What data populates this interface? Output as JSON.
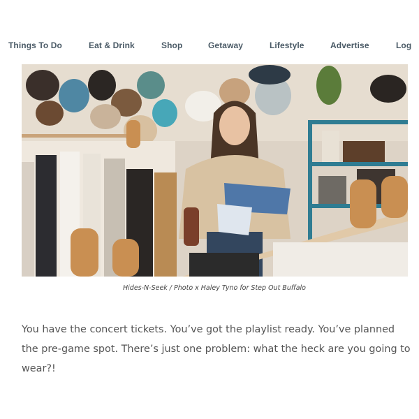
{
  "nav": {
    "items": [
      {
        "label": "Things To Do"
      },
      {
        "label": "Eat & Drink"
      },
      {
        "label": "Shop"
      },
      {
        "label": "Getaway"
      },
      {
        "label": "Lifestyle"
      },
      {
        "label": "Advertise"
      },
      {
        "label": "Log"
      }
    ]
  },
  "article": {
    "photo_caption": "Hides-N-Seek / Photo x Haley Tyno for Step Out Buffalo",
    "intro": "You have the concert tickets. You’ve got the playlist ready. You’ve planned the pre-game spot. There’s just one problem: what the heck are you going to wear?!"
  },
  "colors": {
    "nav_text": "#4a5a66",
    "body_text": "#555555",
    "shelf_teal": "#2f7c92"
  }
}
